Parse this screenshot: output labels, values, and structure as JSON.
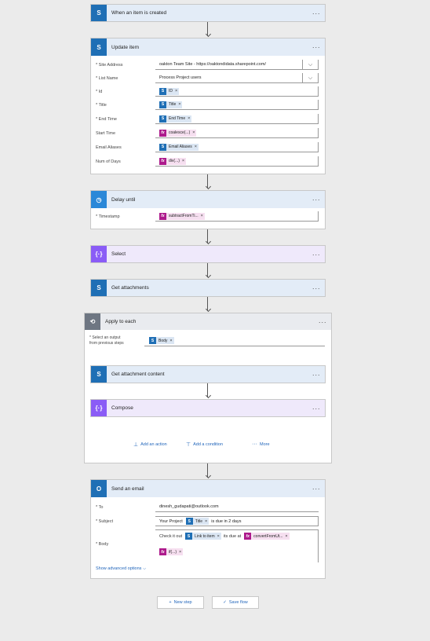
{
  "trigger": {
    "title": "When an item is created",
    "more": "···"
  },
  "update_item": {
    "title": "Update item",
    "more": "···",
    "site_address_label": "* Site Address",
    "site_address_value": "oakton Team Site - https://oaktondidata.sharepoint.com/",
    "list_name_label": "* List Name",
    "list_name_value": "Process Project users",
    "id_label": "* Id",
    "id_token": "ID",
    "title_label": "* Title",
    "title_token": "Title",
    "end_time_label": "* End Time",
    "end_time_token": "End Time",
    "start_time_label": "Start Time",
    "start_time_token": "coalesce(...)",
    "email_aliases_label": "Email Aliases",
    "email_aliases_token": "Email Aliases",
    "num_days_label": "Num of Days",
    "num_days_token": "div(...)"
  },
  "delay_until": {
    "title": "Delay until",
    "more": "···",
    "timestamp_label": "* Timestamp",
    "timestamp_token": "subtractFromTi..."
  },
  "select": {
    "title": "Select",
    "more": "···"
  },
  "get_attachments": {
    "title": "Get attachments",
    "more": "···"
  },
  "apply_each": {
    "title": "Apply to each",
    "more": "···",
    "output_label_1": "* Select an output",
    "output_label_2": "from previous steps",
    "output_token": "Body",
    "get_content_title": "Get attachment content",
    "compose_title": "Compose",
    "add_action": "Add an action",
    "add_condition": "Add a condition",
    "more_label": "More"
  },
  "send_email": {
    "title": "Send an email",
    "more": "···",
    "to_label": "* To",
    "to_value": "dinesh_gudapati@outlook.com",
    "subject_label": "* Subject",
    "subject_prefix": "Your Project",
    "subject_token": "Title",
    "subject_suffix": "is due in 2 days",
    "body_label": "* Body",
    "body_prefix": "Check it out",
    "body_token1": "Link to item",
    "body_mid": "its due at",
    "body_token2": "convertFromUt...",
    "body_token3": "if(...)",
    "advanced": "Show advanced options"
  },
  "footer": {
    "new_step": "New step",
    "save_flow": "Save flow"
  }
}
